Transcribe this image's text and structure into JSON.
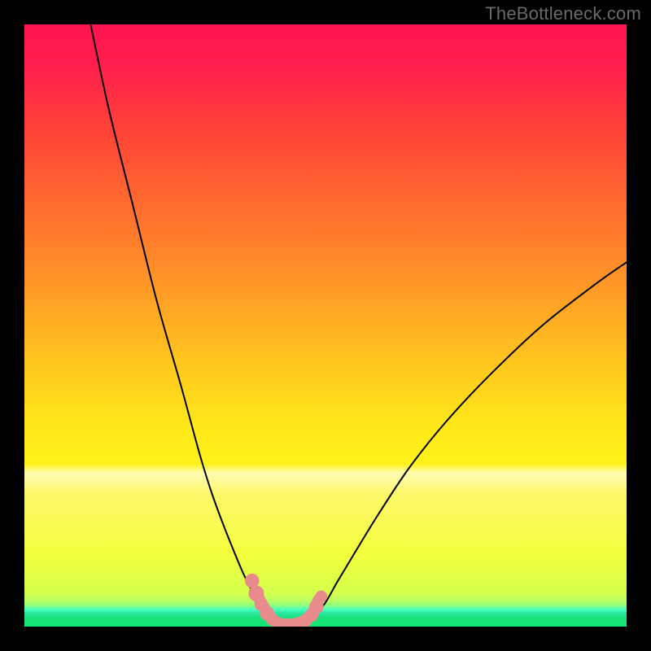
{
  "watermark": "TheBottleneck.com",
  "chart_data": {
    "type": "line",
    "title": "",
    "xlabel": "",
    "ylabel": "",
    "xlim": [
      0,
      100
    ],
    "ylim": [
      0,
      100
    ],
    "background_gradient": {
      "stops": [
        {
          "offset": 0.0,
          "color": "#ff1452"
        },
        {
          "offset": 0.07,
          "color": "#ff1f4c"
        },
        {
          "offset": 0.18,
          "color": "#ff4438"
        },
        {
          "offset": 0.3,
          "color": "#ff6b2f"
        },
        {
          "offset": 0.42,
          "color": "#ff9328"
        },
        {
          "offset": 0.55,
          "color": "#ffc21f"
        },
        {
          "offset": 0.66,
          "color": "#ffe61a"
        },
        {
          "offset": 0.73,
          "color": "#fff21a"
        },
        {
          "offset": 0.745,
          "color": "#fffcb3"
        },
        {
          "offset": 0.78,
          "color": "#fff86a"
        },
        {
          "offset": 0.88,
          "color": "#f3ff3d"
        },
        {
          "offset": 0.945,
          "color": "#d4ff4d"
        },
        {
          "offset": 0.958,
          "color": "#b6ff66"
        },
        {
          "offset": 0.965,
          "color": "#8cff7f"
        },
        {
          "offset": 0.97,
          "color": "#5cffaf"
        },
        {
          "offset": 0.973,
          "color": "#3fffbd"
        },
        {
          "offset": 0.977,
          "color": "#2de8a4"
        },
        {
          "offset": 0.985,
          "color": "#19e07a"
        },
        {
          "offset": 1.0,
          "color": "#14e874"
        }
      ]
    },
    "series": [
      {
        "name": "left-curve",
        "color": "#000000",
        "x": [
          11,
          14,
          18,
          22,
          26,
          29,
          31,
          33,
          35,
          36.5,
          38,
          39,
          40,
          41,
          41.8
        ],
        "y": [
          100,
          86,
          70,
          54,
          40,
          29,
          22.5,
          17,
          12,
          8.5,
          5.5,
          3.5,
          2,
          1,
          0.4
        ]
      },
      {
        "name": "right-curve",
        "color": "#000000",
        "x": [
          47,
          48,
          50,
          52,
          55,
          59,
          64,
          70,
          77,
          86,
          95,
          100
        ],
        "y": [
          0.4,
          1.5,
          4,
          7.5,
          12.5,
          19,
          26.5,
          34,
          41.5,
          50,
          57,
          60.5
        ]
      },
      {
        "name": "valley-floor-stroke",
        "color": "#e98b8c",
        "x": [
          38.5,
          40,
          41,
          42,
          43,
          44,
          45,
          46,
          47,
          48,
          48.8
        ],
        "y": [
          5.5,
          2.8,
          1.4,
          0.7,
          0.4,
          0.4,
          0.5,
          0.8,
          1.4,
          2.6,
          4.4
        ]
      }
    ],
    "scatter": {
      "name": "valley-dots",
      "color": "#e98b8c",
      "points": [
        {
          "x": 37.8,
          "y": 7.6,
          "r": 1.2
        },
        {
          "x": 38.5,
          "y": 5.5,
          "r": 1.3
        },
        {
          "x": 39.3,
          "y": 3.7,
          "r": 1.1
        },
        {
          "x": 40.3,
          "y": 2.2,
          "r": 1.2
        },
        {
          "x": 41.1,
          "y": 1.2,
          "r": 1.0
        },
        {
          "x": 46.8,
          "y": 1.0,
          "r": 1.0
        },
        {
          "x": 47.7,
          "y": 1.9,
          "r": 1.1
        },
        {
          "x": 48.5,
          "y": 3.3,
          "r": 1.2
        },
        {
          "x": 49.3,
          "y": 5.0,
          "r": 1.0
        }
      ]
    }
  }
}
